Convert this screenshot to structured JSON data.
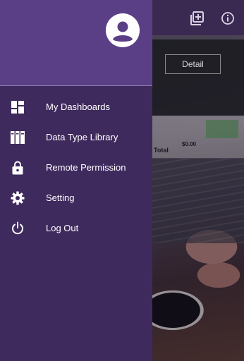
{
  "toolbar": {
    "add_icon": "add-to-library-icon",
    "info_icon": "info-icon"
  },
  "content": {
    "detail_button": "Detail",
    "photo_total_label": "Total",
    "photo_total_value": "$0.00"
  },
  "drawer": {
    "avatar_icon": "account-circle-icon",
    "items": [
      {
        "label": "My Dashboards",
        "icon": "dashboard-icon"
      },
      {
        "label": "Data Type Library",
        "icon": "library-columns-icon"
      },
      {
        "label": "Remote Permission",
        "icon": "lock-icon"
      },
      {
        "label": "Setting",
        "icon": "gear-icon"
      },
      {
        "label": "Log Out",
        "icon": "power-icon"
      }
    ]
  },
  "colors": {
    "drawer_background": "#3f2a5e",
    "drawer_header": "#5a3f87",
    "text": "#ffffff"
  }
}
